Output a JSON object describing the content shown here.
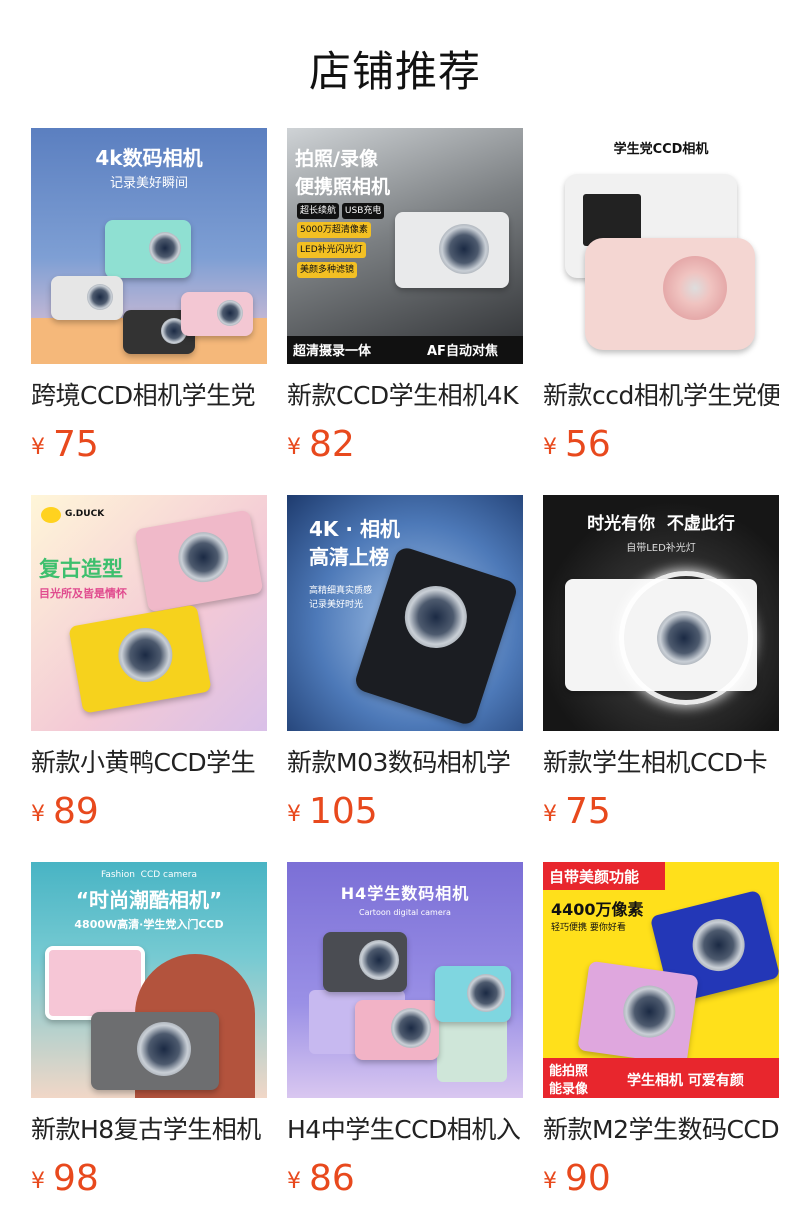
{
  "page": {
    "title": "店铺推荐"
  },
  "currency": "¥",
  "products": [
    {
      "name": "跨境CCD相机学生党",
      "price": "75",
      "image": {
        "headline": "4k数码相机",
        "sub": "记录美好瞬间"
      }
    },
    {
      "name": "新款CCD学生相机4K",
      "price": "82",
      "image": {
        "headline": "拍照/录像",
        "headline2": "便携照相机",
        "tags": [
          "超长续航",
          "USB充电",
          "5000万超清像素",
          "LED补光闪光灯",
          "美颜多种滤镜"
        ],
        "footer": "超清摄录一体",
        "footer2": "AF自动对焦"
      }
    },
    {
      "name": "新款ccd相机学生党便",
      "price": "56",
      "image": {
        "headline": "学生党CCD相机"
      }
    },
    {
      "name": "新款小黄鸭CCD学生",
      "price": "89",
      "image": {
        "brand": "G.DUCK",
        "headline": "复古造型",
        "sub": "目光所及皆是情怀"
      }
    },
    {
      "name": "新款M03数码相机学",
      "price": "105",
      "image": {
        "headline": "4K · 相机",
        "headline2": "高清上榜",
        "sub": "高精细真实质感",
        "sub2": "记录美好时光"
      }
    },
    {
      "name": "新款学生相机CCD卡",
      "price": "75",
      "image": {
        "headline": "时光有你  不虚此行",
        "sub": "自带LED补光灯"
      }
    },
    {
      "name": "新款H8复古学生相机",
      "price": "98",
      "image": {
        "tag": "Fashion  CCD camera",
        "headline": "“时尚潮酷相机”",
        "sub": "4800W高清·学生党入门CCD"
      }
    },
    {
      "name": "H4中学生CCD相机入",
      "price": "86",
      "image": {
        "headline": "H4学生数码相机",
        "sub": "Cartoon digital camera"
      }
    },
    {
      "name": "新款M2学生数码CCD",
      "price": "90",
      "image": {
        "badge": "自带美颜功能",
        "headline": "4400万像素",
        "sub": "轻巧便携 要你好看",
        "footer": "能拍照",
        "footer2": "能录像",
        "footer3": "学生相机 可爱有颜"
      }
    }
  ]
}
